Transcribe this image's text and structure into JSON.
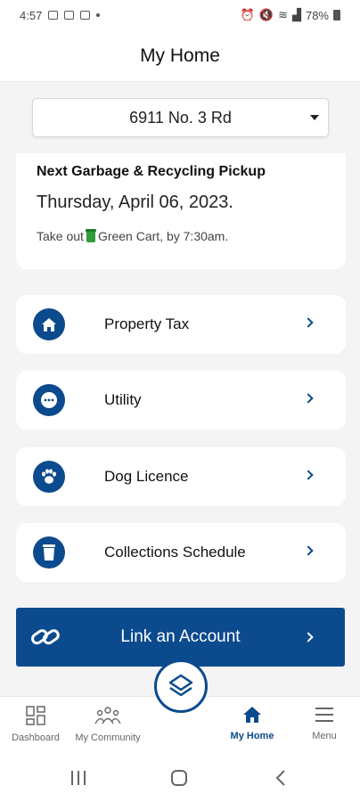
{
  "status_bar": {
    "time": "4:57",
    "battery": "78%"
  },
  "header": {
    "title": "My Home"
  },
  "address": {
    "value": "6911 No. 3 Rd"
  },
  "pickup": {
    "title": "Next Garbage & Recycling Pickup",
    "date": "Thursday, April 06, 2023.",
    "note_prefix": "Take out",
    "note_suffix": "Green Cart, by 7:30am."
  },
  "menu": [
    {
      "label": "Property Tax",
      "icon": "home-icon"
    },
    {
      "label": "Utility",
      "icon": "chat-dots-icon"
    },
    {
      "label": "Dog Licence",
      "icon": "paw-icon"
    },
    {
      "label": "Collections Schedule",
      "icon": "trash-bin-icon"
    }
  ],
  "link_account": {
    "label": "Link an Account"
  },
  "bottom_nav": [
    {
      "label": "Dashboard",
      "icon": "dashboard-icon"
    },
    {
      "label": "My Community",
      "icon": "community-icon"
    },
    {
      "label": "My Home",
      "icon": "home-icon"
    },
    {
      "label": "Menu",
      "icon": "hamburger-icon"
    }
  ],
  "colors": {
    "brand": "#0c4a8e",
    "cart_green": "#2e9e3a",
    "background": "#f4f4f4"
  }
}
